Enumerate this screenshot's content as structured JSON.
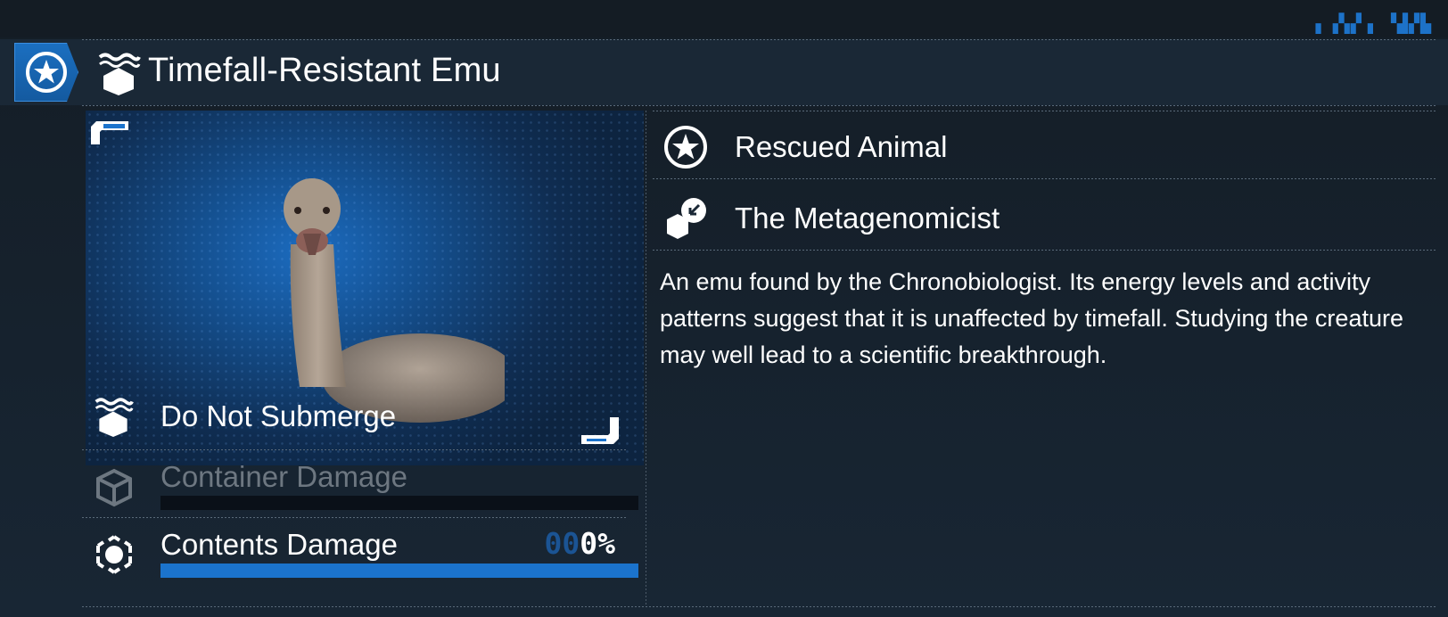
{
  "item": {
    "name": "Timefall-Resistant Emu",
    "badge_icon": "star-circle-icon",
    "type_icon": "do-not-submerge-icon"
  },
  "image": {
    "subject": "emu-image"
  },
  "handling": {
    "label": "Do Not Submerge",
    "icon": "do-not-submerge-icon"
  },
  "container_damage": {
    "label": "Container Damage",
    "icon": "box-outline-icon",
    "level": 0,
    "state": "disabled"
  },
  "contents_damage": {
    "label": "Contents Damage",
    "icon": "contents-target-icon",
    "value_dim": "00",
    "value_lit": "0%",
    "level": 1.0
  },
  "info": {
    "category": {
      "label": "Rescued Animal",
      "icon": "star-circle-icon"
    },
    "client": {
      "label": "The Metagenomicist",
      "icon": "delivery-client-icon"
    },
    "description": "An emu found by the Chronobiologist. Its energy levels and activity patterns suggest that it is unaffected by timefall. Studying the creature may well lead to a scientific breakthrough."
  },
  "colors": {
    "accent": "#1b73cc",
    "panel": "#1a2836",
    "text": "#ffffff",
    "disabled_text": "#6d7781"
  }
}
